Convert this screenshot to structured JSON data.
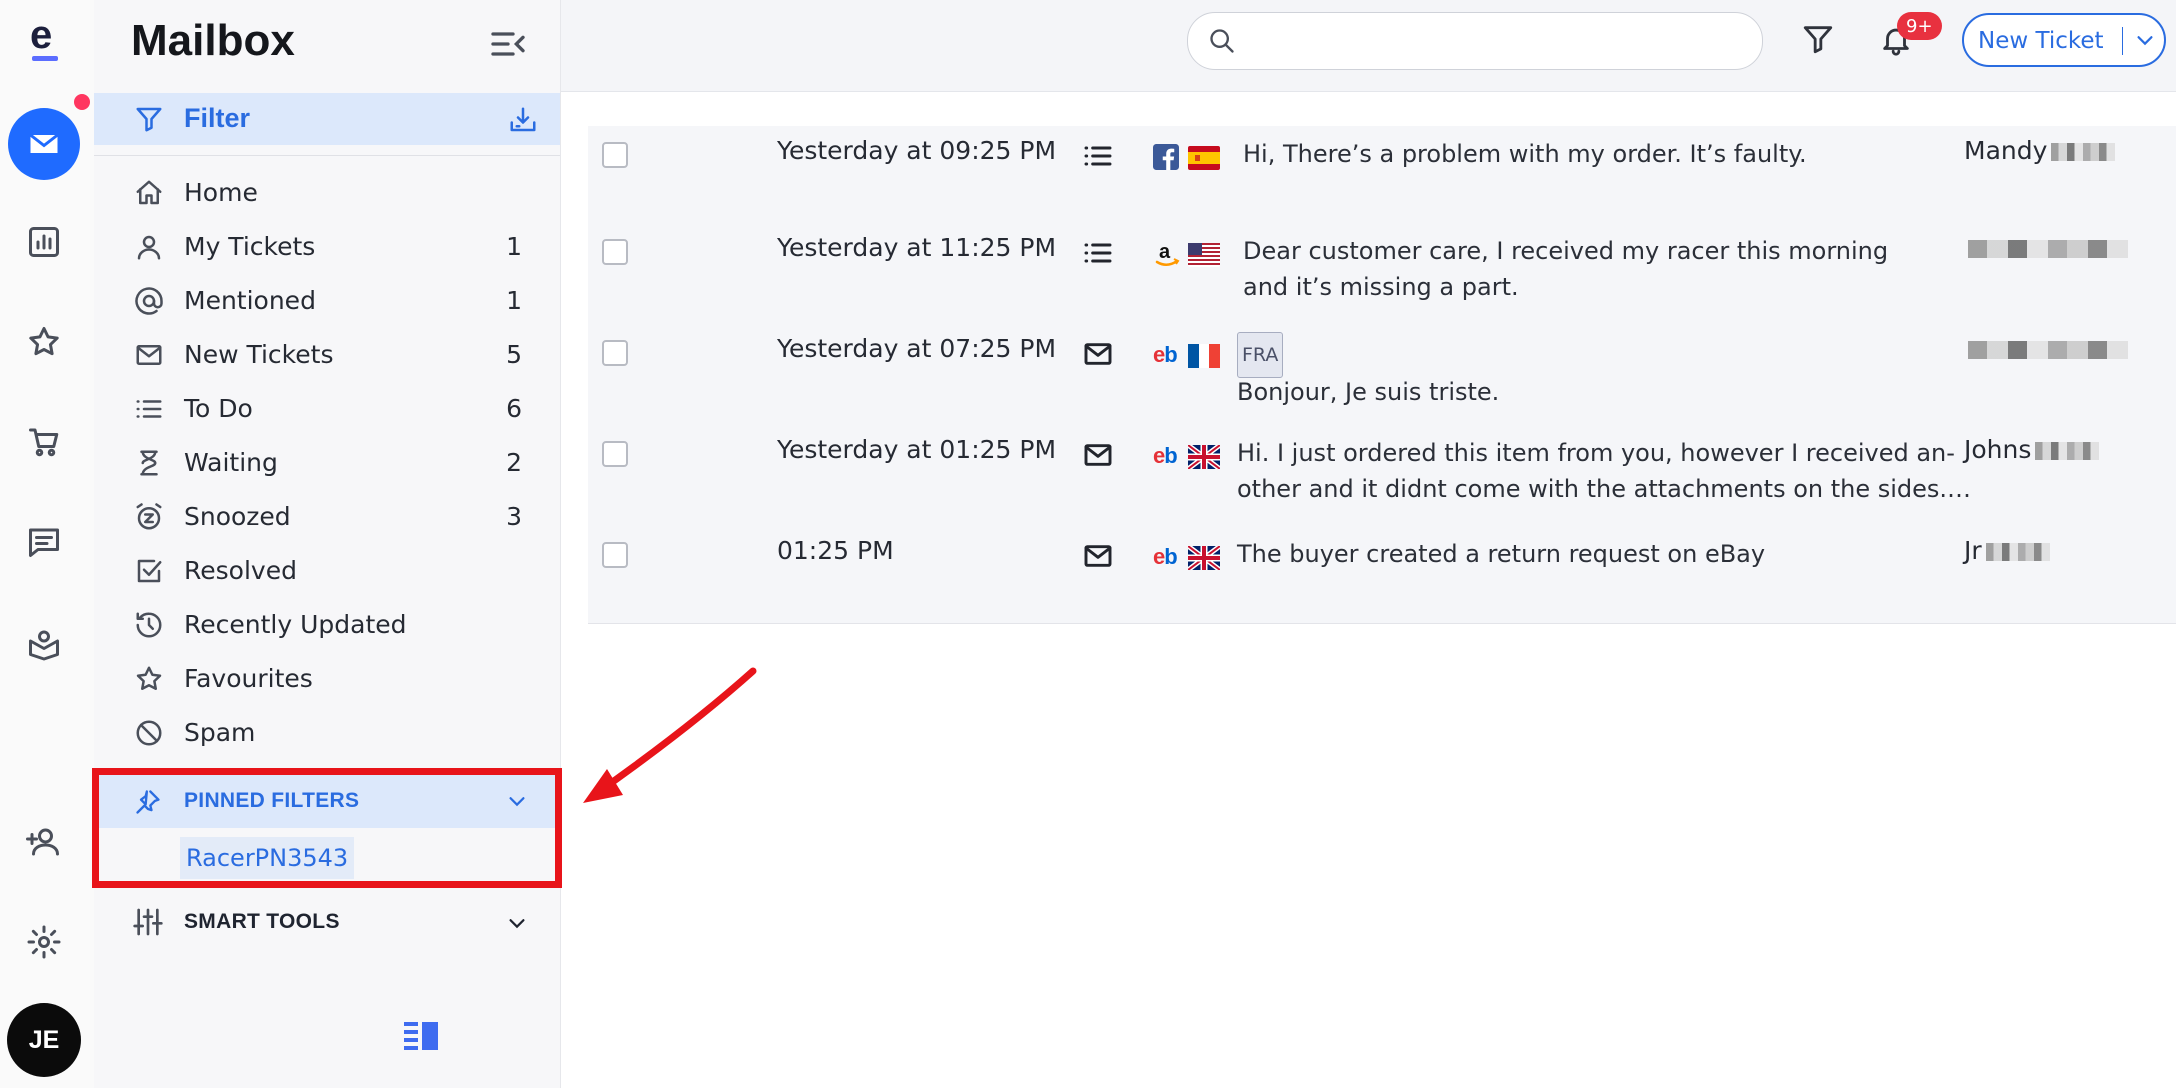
{
  "app": {
    "title": "Mailbox",
    "logo_letter": "e"
  },
  "rail": {
    "items": [
      "mail-icon",
      "bar-chart-icon",
      "star-icon",
      "cart-icon",
      "chat-icon",
      "knowledge-icon",
      "add-user-icon",
      "gear-icon"
    ],
    "avatar_initials": "JE"
  },
  "sidebar": {
    "filter_label": "Filter",
    "nav": [
      {
        "label": "Home",
        "count": "",
        "icon": "home-icon"
      },
      {
        "label": "My Tickets",
        "count": "1",
        "icon": "user-icon"
      },
      {
        "label": "Mentioned",
        "count": "1",
        "icon": "at-icon"
      },
      {
        "label": "New Tickets",
        "count": "5",
        "icon": "mail-icon"
      },
      {
        "label": "To Do",
        "count": "6",
        "icon": "list-icon"
      },
      {
        "label": "Waiting",
        "count": "2",
        "icon": "hourglass-icon"
      },
      {
        "label": "Snoozed",
        "count": "3",
        "icon": "snooze-icon"
      },
      {
        "label": "Resolved",
        "count": "",
        "icon": "check-square-icon"
      },
      {
        "label": "Recently Updated",
        "count": "",
        "icon": "history-icon"
      },
      {
        "label": "Favourites",
        "count": "",
        "icon": "star-icon"
      },
      {
        "label": "Spam",
        "count": "",
        "icon": "block-icon"
      }
    ],
    "pinned": {
      "label": "PINNED FILTERS",
      "items": [
        "RacerPN3543"
      ]
    },
    "smart_tools": {
      "label": "SMART TOOLS"
    }
  },
  "topbar": {
    "search_placeholder": "",
    "notification_badge": "9+",
    "new_ticket_label": "New Ticket"
  },
  "tickets": [
    {
      "date": "Yesterday at 09:25 PM",
      "type": "list-icon",
      "channel": "facebook",
      "flag": "ES",
      "lang_tag": "",
      "subject_line1": "Hi, There’s a problem with my order. It’s faulty.",
      "subject_line2": "",
      "customer": "Mandy"
    },
    {
      "date": "Yesterday at 11:25 PM",
      "type": "list-icon",
      "channel": "amazon",
      "flag": "US",
      "lang_tag": "",
      "subject_line1": "Dear customer care, I received my racer this morning",
      "subject_line2": "and it’s missing a part.",
      "customer": ""
    },
    {
      "date": "Yesterday at 07:25 PM",
      "type": "mail-icon",
      "channel": "ebay",
      "flag": "FR",
      "lang_tag": "FRA",
      "subject_line1": "",
      "subject_line2": "Bonjour, Je suis triste.",
      "customer": ""
    },
    {
      "date": "Yesterday at 01:25 PM",
      "type": "mail-icon",
      "channel": "ebay",
      "flag": "GB",
      "lang_tag": "",
      "subject_line1": "Hi. I just ordered this item from you, however I received an-",
      "subject_line2": "other and it didnt come with the attachments on the sides.…",
      "customer": "Johns"
    },
    {
      "date": "01:25 PM",
      "type": "mail-icon",
      "channel": "ebay",
      "flag": "GB",
      "lang_tag": "",
      "subject_line1": "The buyer created a return request on eBay",
      "subject_line2": "",
      "customer": "Jr"
    }
  ],
  "colors": {
    "accent": "#2a6ce0",
    "highlight": "#e8141a",
    "badge": "#e8313f",
    "active_bg": "#dce8fb"
  }
}
